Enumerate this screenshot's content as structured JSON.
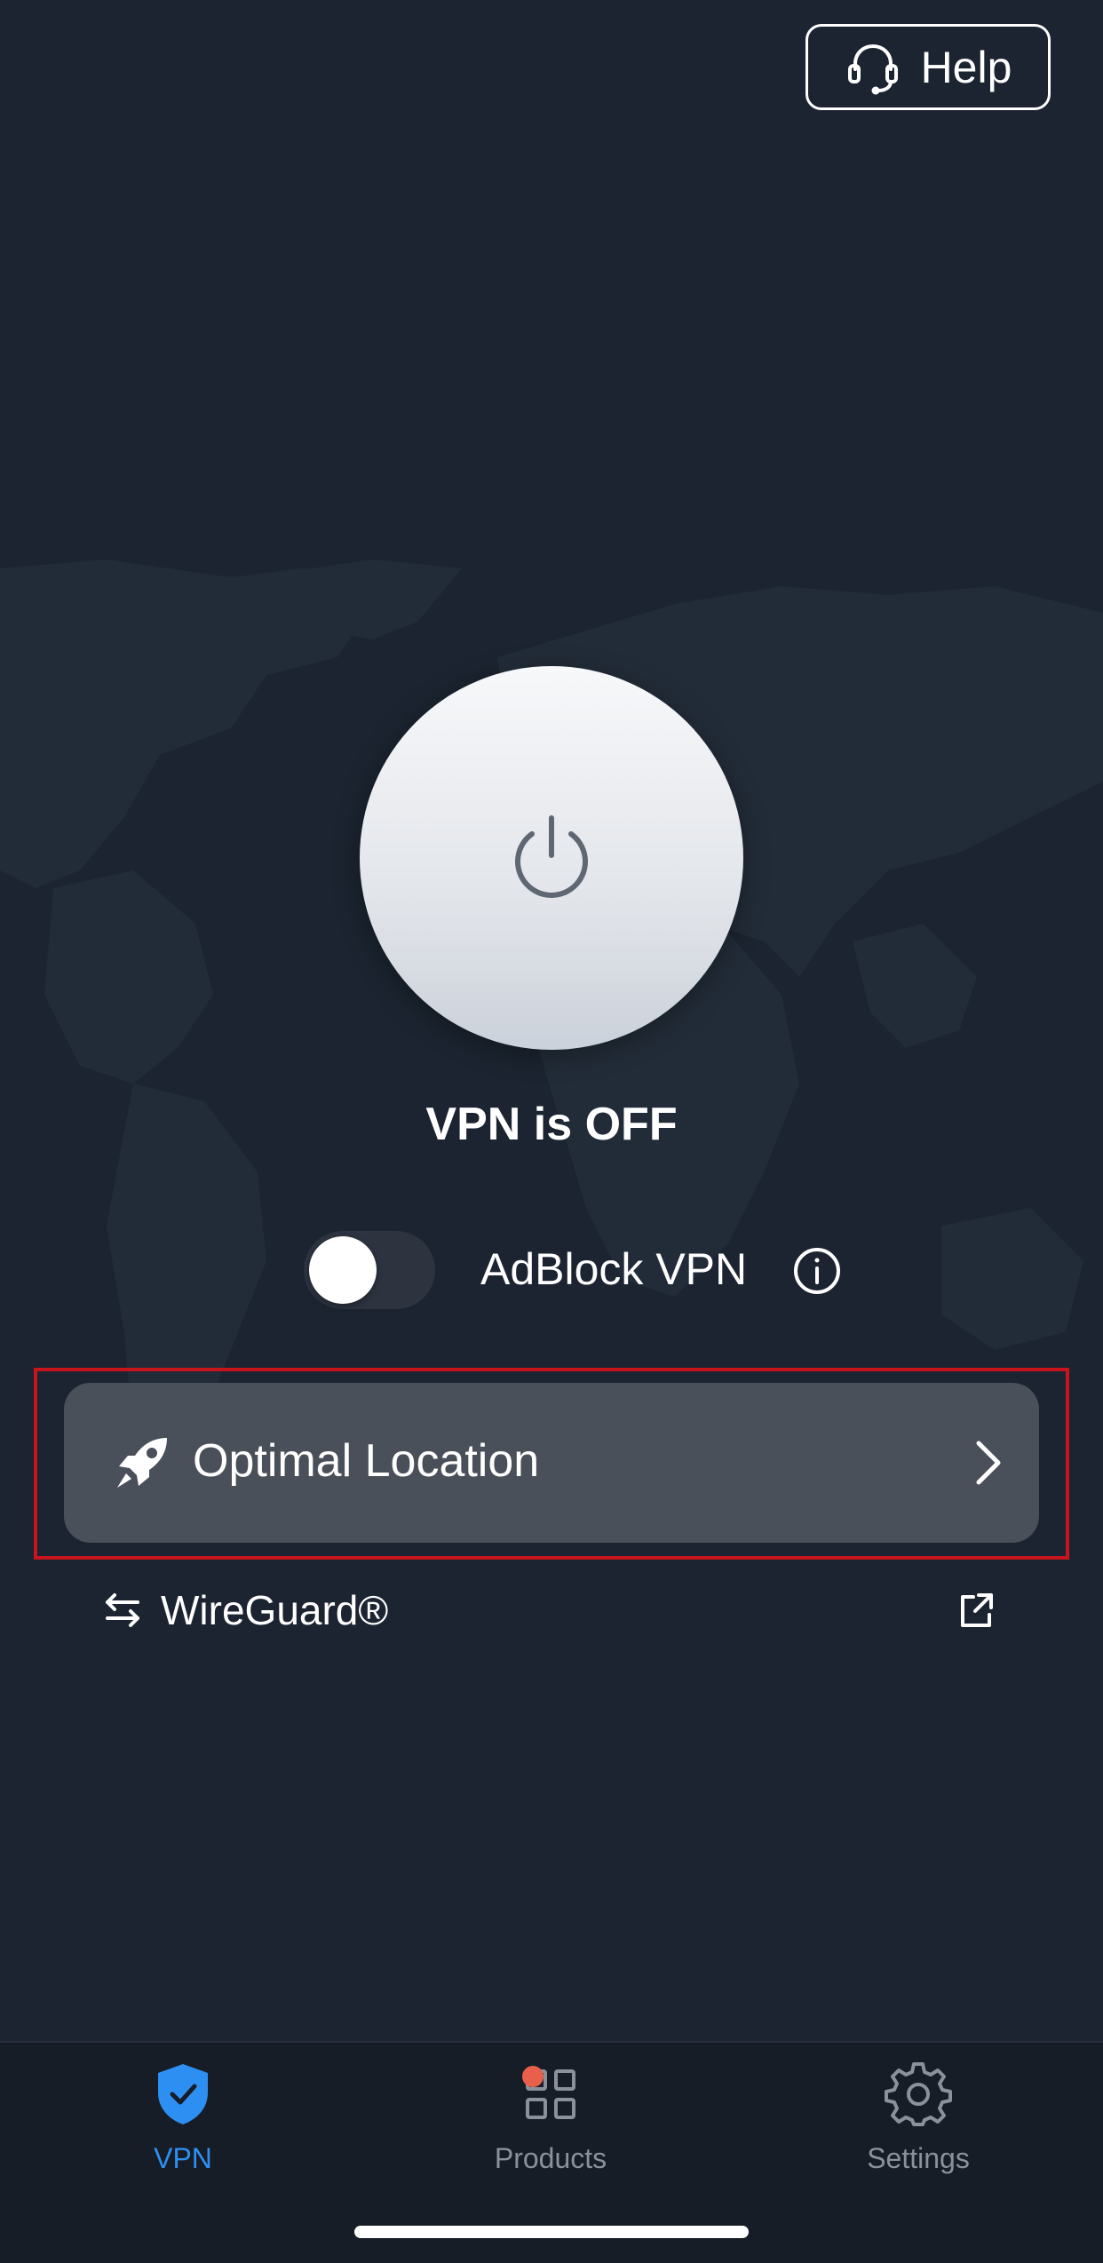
{
  "header": {
    "help_label": "Help",
    "help_icon": "headset-icon"
  },
  "vpn": {
    "status_text": "VPN is OFF",
    "power_icon": "power-icon",
    "connected": false
  },
  "adblock": {
    "label": "AdBlock VPN",
    "enabled": false,
    "info_icon": "info-icon"
  },
  "location": {
    "label": "Optimal Location",
    "icon": "rocket-icon",
    "chevron_icon": "chevron-right-icon"
  },
  "protocol": {
    "label": "WireGuard®",
    "icon": "swap-arrows-icon",
    "link_icon": "external-link-icon"
  },
  "tabs": [
    {
      "label": "VPN",
      "icon": "shield-check-icon",
      "active": true
    },
    {
      "label": "Products",
      "icon": "grid-icon",
      "active": false,
      "badge": true
    },
    {
      "label": "Settings",
      "icon": "gear-icon",
      "active": false
    }
  ],
  "colors": {
    "background": "#1b2430",
    "accent": "#2e8ff2",
    "card": "#4a5059",
    "highlight": "#c8141c",
    "badge": "#e8604c"
  }
}
